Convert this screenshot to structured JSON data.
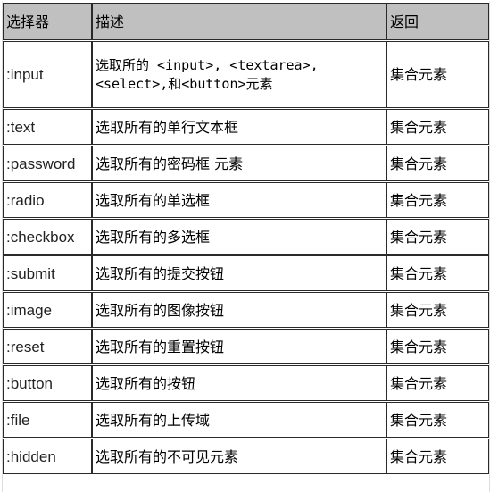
{
  "headers": [
    "选择器",
    "描述",
    "返回"
  ],
  "rows": [
    {
      "selector": ":input",
      "description_line1": "选取所的 <input>, <textarea>,",
      "description_line2": "<select>,和<button>元素",
      "returns": "集合元素"
    },
    {
      "selector": ":text",
      "description": "选取所有的单行文本框",
      "returns": "集合元素"
    },
    {
      "selector": ":password",
      "description": "选取所有的密码框 元素",
      "returns": "集合元素"
    },
    {
      "selector": ":radio",
      "description": "选取所有的单选框",
      "returns": "集合元素"
    },
    {
      "selector": ":checkbox",
      "description": "选取所有的多选框",
      "returns": "集合元素"
    },
    {
      "selector": ":submit",
      "description": "选取所有的提交按钮",
      "returns": "集合元素"
    },
    {
      "selector": ":image",
      "description": "选取所有的图像按钮",
      "returns": "集合元素"
    },
    {
      "selector": ":reset",
      "description": "选取所有的重置按钮",
      "returns": "集合元素"
    },
    {
      "selector": ":button",
      "description": "选取所有的按钮",
      "returns": "集合元素"
    },
    {
      "selector": ":file",
      "description": "选取所有的上传域",
      "returns": "集合元素"
    },
    {
      "selector": ":hidden",
      "description": "选取所有的不可见元素",
      "returns": "集合元素"
    }
  ],
  "colors": {
    "header_bg": "#c0c0c0",
    "border": "#2a2a2a"
  }
}
